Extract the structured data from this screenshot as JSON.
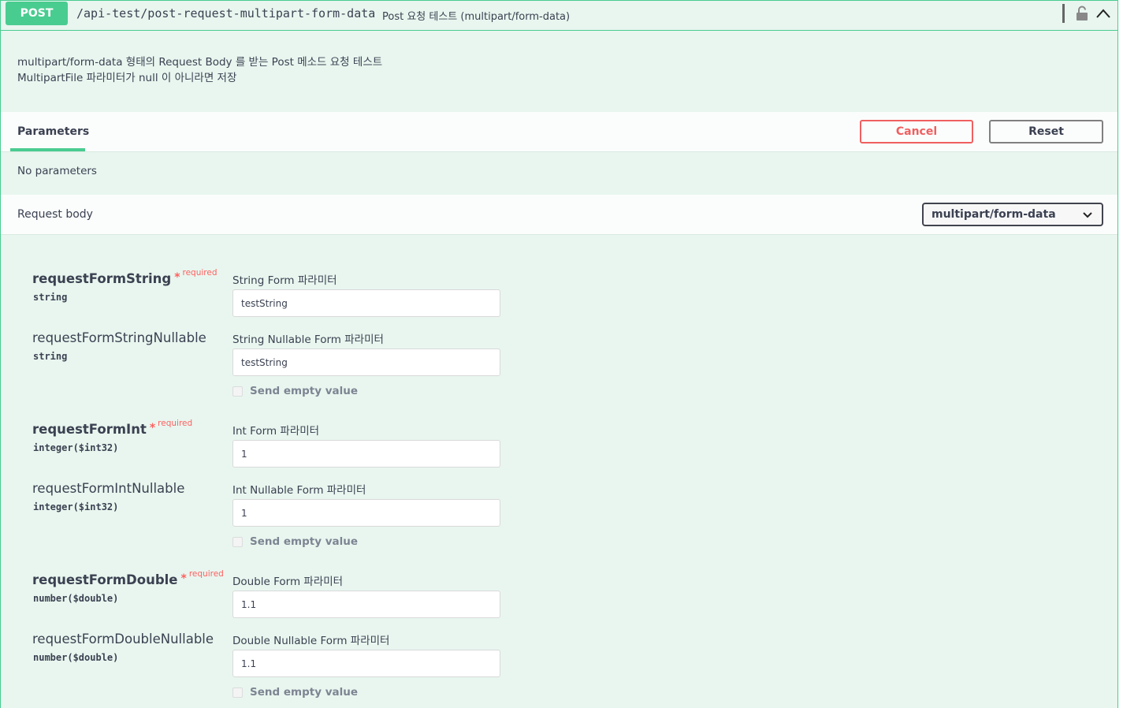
{
  "summary": {
    "method": "POST",
    "path": "/api-test/post-request-multipart-form-data",
    "description": "Post 요청 테스트 (multipart/form-data)"
  },
  "description": {
    "line1": "multipart/form-data 형태의 Request Body 를 받는 Post 메소드 요청 테스트",
    "line2": "MultipartFile 파라미터가 null 이 아니라면 저장"
  },
  "tabs": {
    "parameters_label": "Parameters",
    "cancel_label": "Cancel",
    "reset_label": "Reset"
  },
  "no_parameters": "No parameters",
  "request_body": {
    "label": "Request body",
    "content_type": "multipart/form-data"
  },
  "required_text": "required",
  "send_empty_label": "Send empty value",
  "params": [
    {
      "name": "requestFormString",
      "type": "string",
      "label": "String Form 파라미터",
      "value": "testString"
    },
    {
      "name": "requestFormStringNullable",
      "type": "string",
      "label": "String Nullable Form 파라미터",
      "value": "testString"
    },
    {
      "name": "requestFormInt",
      "type": "integer($int32)",
      "label": "Int Form 파라미터",
      "value": "1"
    },
    {
      "name": "requestFormIntNullable",
      "type": "integer($int32)",
      "label": "Int Nullable Form 파라미터",
      "value": "1"
    },
    {
      "name": "requestFormDouble",
      "type": "number($double)",
      "label": "Double Form 파라미터",
      "value": "1.1"
    },
    {
      "name": "requestFormDoubleNullable",
      "type": "number($double)",
      "label": "Double Nullable Form 파라미터",
      "value": "1.1"
    }
  ]
}
